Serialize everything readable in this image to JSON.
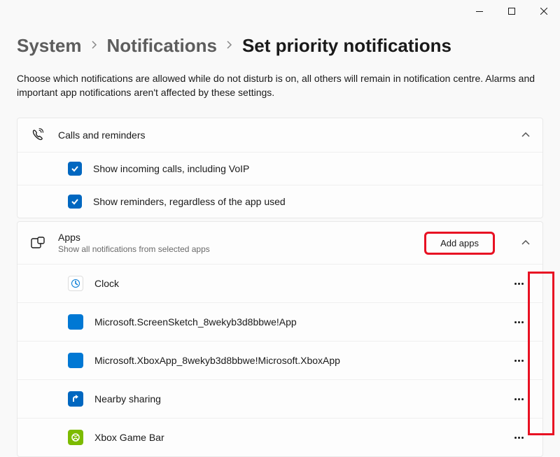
{
  "titlebar": {
    "minimize": "–",
    "maximize": "□",
    "close": "✕"
  },
  "breadcrumb": {
    "items": [
      "System",
      "Notifications"
    ],
    "current": "Set priority notifications"
  },
  "description": "Choose which notifications are allowed while do not disturb is on, all others will remain in notification centre. Alarms and important app notifications aren't affected by these settings.",
  "sections": {
    "calls": {
      "title": "Calls and reminders",
      "options": [
        {
          "label": "Show incoming calls, including VoIP",
          "checked": true
        },
        {
          "label": "Show reminders, regardless of the app used",
          "checked": true
        }
      ]
    },
    "apps": {
      "title": "Apps",
      "subtitle": "Show all notifications from selected apps",
      "add_button": "Add apps",
      "items": [
        {
          "name": "Clock",
          "icon": "clock",
          "color": "#0078d4"
        },
        {
          "name": "Microsoft.ScreenSketch_8wekyb3d8bbwe!App",
          "icon": "generic",
          "color": "#0078d4"
        },
        {
          "name": "Microsoft.XboxApp_8wekyb3d8bbwe!Microsoft.XboxApp",
          "icon": "generic",
          "color": "#0078d4"
        },
        {
          "name": "Nearby sharing",
          "icon": "share",
          "color": "#0067c0"
        },
        {
          "name": "Xbox Game Bar",
          "icon": "xbox",
          "color": "#7cbb00"
        }
      ]
    }
  }
}
